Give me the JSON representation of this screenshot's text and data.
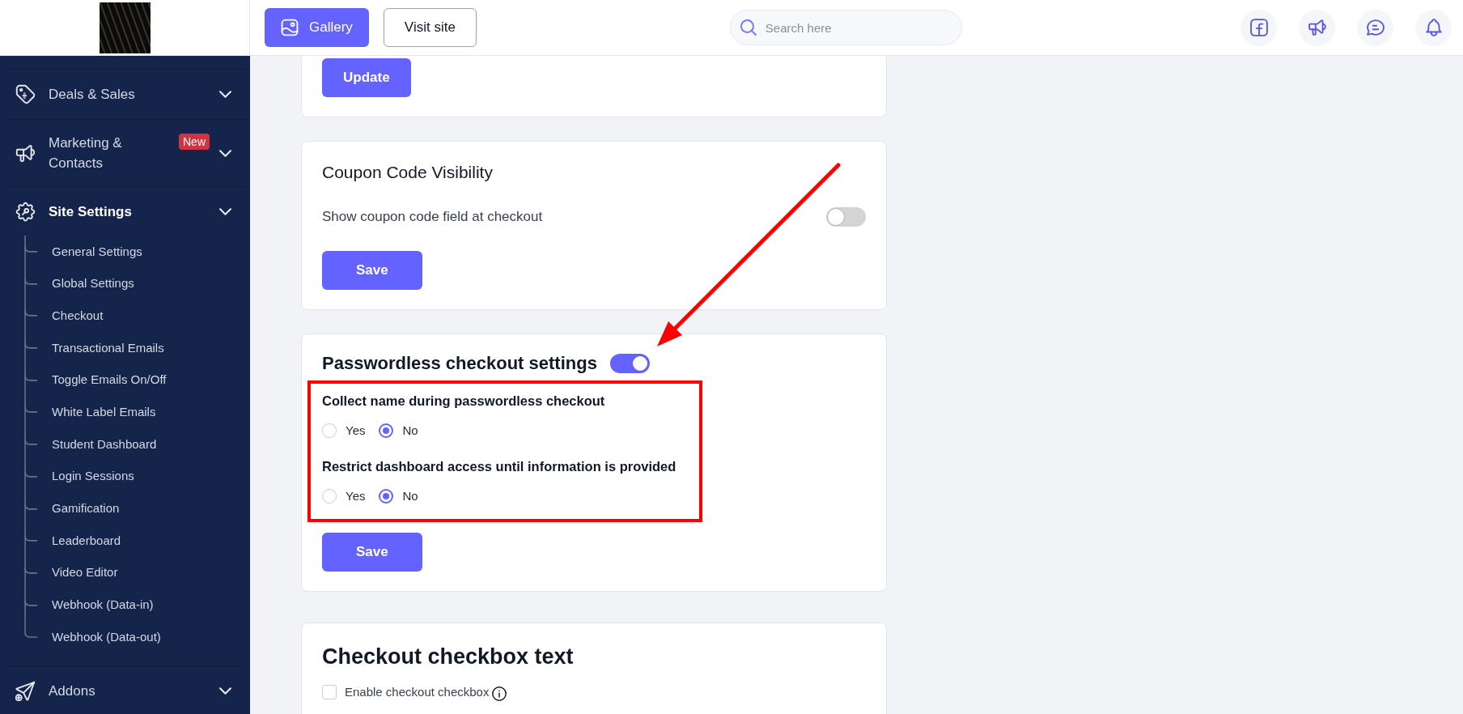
{
  "topbar": {
    "buttons": [
      {
        "label": "Gallery",
        "kind": "primary"
      },
      {
        "label": "Visit site",
        "kind": "outline"
      }
    ],
    "search": {
      "placeholder": "Search here"
    }
  },
  "sidebar": {
    "items": [
      {
        "label": "Deals & Sales",
        "selected": false
      },
      {
        "label": "Marketing & Contacts",
        "badge": "New",
        "selected": false
      },
      {
        "label": "Site Settings",
        "selected": true,
        "children": [
          {
            "label": "General Settings",
            "selected": false
          },
          {
            "label": "Global Settings",
            "selected": false
          },
          {
            "label": "Checkout",
            "selected": false
          },
          {
            "label": "Transactional Emails",
            "selected": false
          },
          {
            "label": "Toggle Emails On/Off",
            "selected": false
          },
          {
            "label": "White Label Emails",
            "selected": false
          },
          {
            "label": "Student Dashboard",
            "selected": false
          },
          {
            "label": "Login Sessions",
            "selected": false
          },
          {
            "label": "Gamification",
            "selected": false
          },
          {
            "label": "Leaderboard",
            "selected": false
          },
          {
            "label": "Video Editor",
            "selected": false
          },
          {
            "label": "Webhook (Data-in)",
            "selected": false
          },
          {
            "label": "Webhook (Data-out)",
            "selected": false
          }
        ]
      },
      {
        "label": "Addons",
        "selected": false
      }
    ]
  },
  "cards": [
    {
      "blocks": [
        {
          "kind": "button",
          "label": "Update"
        }
      ]
    },
    {
      "blocks": [
        {
          "kind": "title",
          "text": "Coupon Code Visibility"
        },
        {
          "kind": "toggle_row",
          "label": "Show coupon code field at checkout",
          "on": false
        },
        {
          "kind": "button",
          "label": "Save"
        }
      ]
    },
    {
      "blocks": [
        {
          "kind": "title_toggle",
          "text": "Passwordless checkout settings",
          "on": true
        },
        {
          "kind": "highlighted_group",
          "questions": [
            {
              "label": "Collect name during passwordless checkout",
              "options": [
                {
                  "label": "Yes",
                  "selected": false
                },
                {
                  "label": "No",
                  "selected": true
                }
              ]
            },
            {
              "label": "Restrict dashboard access until information is provided",
              "options": [
                {
                  "label": "Yes",
                  "selected": false
                },
                {
                  "label": "No",
                  "selected": true
                }
              ]
            }
          ]
        },
        {
          "kind": "button",
          "label": "Save"
        }
      ]
    },
    {
      "blocks": [
        {
          "kind": "heading",
          "text": "Checkout checkbox text"
        },
        {
          "kind": "checkbox_row",
          "label": "Enable checkout checkbox",
          "checked": false
        }
      ]
    }
  ]
}
